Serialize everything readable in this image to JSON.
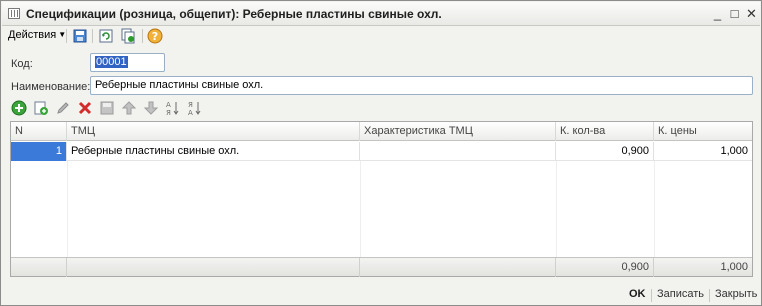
{
  "window": {
    "title": "Спецификации (розница, общепит): Реберные пластины свиные охл.",
    "minimize": "_",
    "maximize": "□",
    "close": "✕"
  },
  "toolbar": {
    "actions_label": "Действия",
    "icons": [
      "save-down-icon",
      "refresh-doc-icon",
      "copy-doc-icon",
      "help-icon"
    ]
  },
  "form": {
    "code_label": "Код:",
    "code_value": "00001",
    "name_label": "Наименование:",
    "name_value": "Реберные пластины свиные охл."
  },
  "table_toolbar": {
    "icons": [
      "add-icon",
      "add-copy-icon",
      "edit-icon",
      "delete-icon",
      "save-icon",
      "move-up-icon",
      "move-down-icon",
      "sort-asc-icon",
      "sort-desc-icon"
    ]
  },
  "table": {
    "columns": [
      "N",
      "ТМЦ",
      "Характеристика ТМЦ",
      "К. кол-ва",
      "К. цены"
    ],
    "rows": [
      {
        "n": "1",
        "tmc": "Реберные пластины свиные охл.",
        "char": "",
        "qty": "0,900",
        "price": "1,000"
      }
    ],
    "totals": {
      "qty": "0,900",
      "price": "1,000"
    }
  },
  "footer": {
    "ok": "OK",
    "save": "Записать",
    "close": "Закрыть"
  },
  "colors": {
    "selection": "#3b7ad8",
    "add": "#2e9b2e",
    "delete": "#d12b2b",
    "help": "#e8a21a"
  }
}
